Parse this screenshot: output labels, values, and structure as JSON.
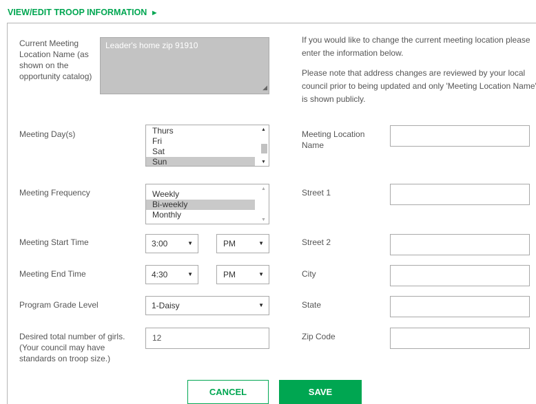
{
  "header": {
    "title": "VIEW/EDIT TROOP INFORMATION",
    "arrow": "►"
  },
  "current_location": {
    "label": "Current Meeting Location Name (as shown on the opportunity catalog)",
    "value": "Leader's home zip 91910"
  },
  "info": {
    "paragraph1": "If you would like to change the current meeting location please enter the information below.",
    "paragraph2": "Please note that address changes are reviewed by your local council prior to being updated and only 'Meeting Location Name' is shown publicly."
  },
  "meeting_days": {
    "label": "Meeting Day(s)",
    "options": [
      "Thurs",
      "Fri",
      "Sat",
      "Sun"
    ],
    "selected": "Sun"
  },
  "meeting_frequency": {
    "label": "Meeting Frequency",
    "options": [
      "Weekly",
      "Bi-weekly",
      "Monthly"
    ],
    "selected": "Bi-weekly"
  },
  "start_time": {
    "label": "Meeting Start Time",
    "time": "3:00",
    "ampm": "PM"
  },
  "end_time": {
    "label": "Meeting End Time",
    "time": "4:30",
    "ampm": "PM"
  },
  "grade_level": {
    "label": "Program Grade Level",
    "value": "1-Daisy"
  },
  "girls": {
    "label": "Desired total number of girls. (Your council may have standards on troop size.)",
    "value": "12"
  },
  "address": {
    "location_name_label": "Meeting Location Name",
    "street1_label": "Street 1",
    "street2_label": "Street 2",
    "city_label": "City",
    "state_label": "State",
    "zip_label": "Zip Code",
    "location_name_value": "",
    "street1_value": "",
    "street2_value": "",
    "city_value": "",
    "state_value": "",
    "zip_value": ""
  },
  "buttons": {
    "cancel": "CANCEL",
    "save": "SAVE"
  },
  "icons": {
    "select_caret": "caret-down-icon",
    "scroll_up": "scroll-up-icon",
    "scroll_down": "scroll-down-icon"
  },
  "colors": {
    "accent": "#00a651",
    "selected_option": "#c9c9c9",
    "readonly_field": "#c3c3c3"
  }
}
